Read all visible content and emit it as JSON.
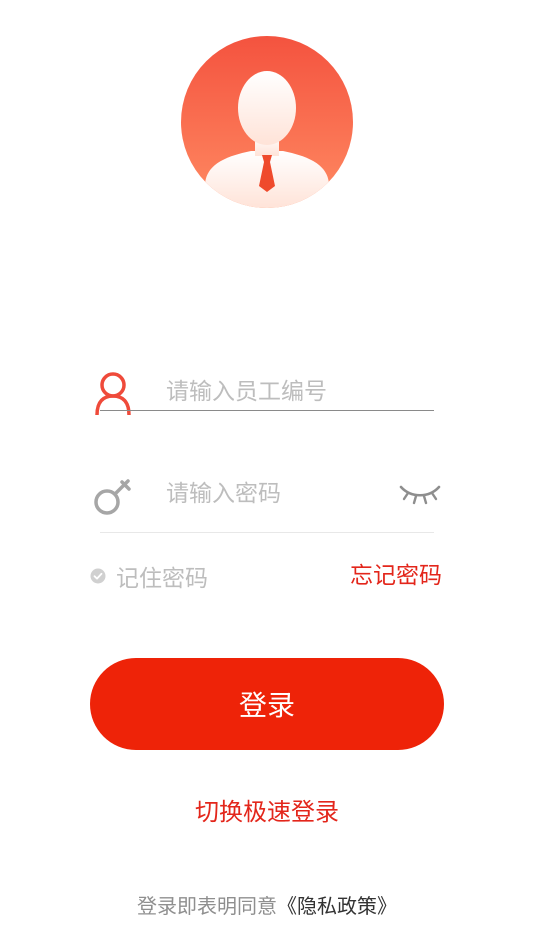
{
  "login": {
    "username_placeholder": "请输入员工编号",
    "username_value": "",
    "password_placeholder": "请输入密码",
    "password_value": "",
    "remember_label": "记住密码",
    "forgot_label": "忘记密码",
    "login_button": "登录",
    "switch_label": "切换极速登录",
    "policy_prefix": "登录即表明同意",
    "policy_link": "《隐私政策》"
  },
  "icons": {
    "avatar": "user-avatar-icon",
    "username": "user-icon",
    "password": "key-icon",
    "visibility": "eye-closed-icon",
    "remember": "check-circle-icon"
  },
  "colors": {
    "accent": "#ee2308",
    "link": "#e3261b",
    "placeholder": "#bdbdbd"
  }
}
